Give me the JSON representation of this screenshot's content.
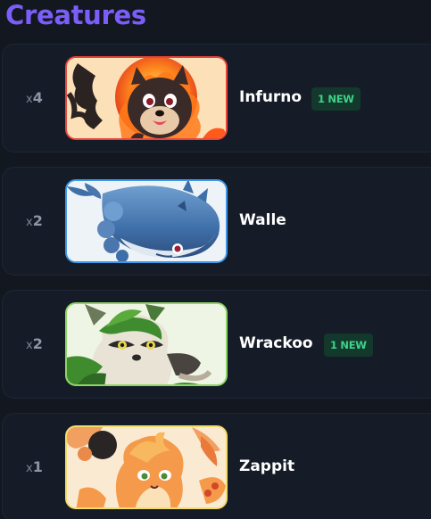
{
  "section_title": "Creatures",
  "creatures": [
    {
      "count_prefix": "x",
      "count": "4",
      "name": "Infurno",
      "badge": "1 NEW",
      "rarity_color": "#e8463c",
      "icon": "fire-creature-portrait"
    },
    {
      "count_prefix": "x",
      "count": "2",
      "name": "Walle",
      "badge": "",
      "rarity_color": "#3f97e8",
      "icon": "whale-creature-portrait"
    },
    {
      "count_prefix": "x",
      "count": "2",
      "name": "Wrackoo",
      "badge": "1 NEW",
      "rarity_color": "#8fd466",
      "icon": "raccoon-creature-portrait"
    },
    {
      "count_prefix": "x",
      "count": "1",
      "name": "Zappit",
      "badge": "",
      "rarity_color": "#f0dc6a",
      "icon": "electric-rabbit-creature-portrait"
    }
  ]
}
